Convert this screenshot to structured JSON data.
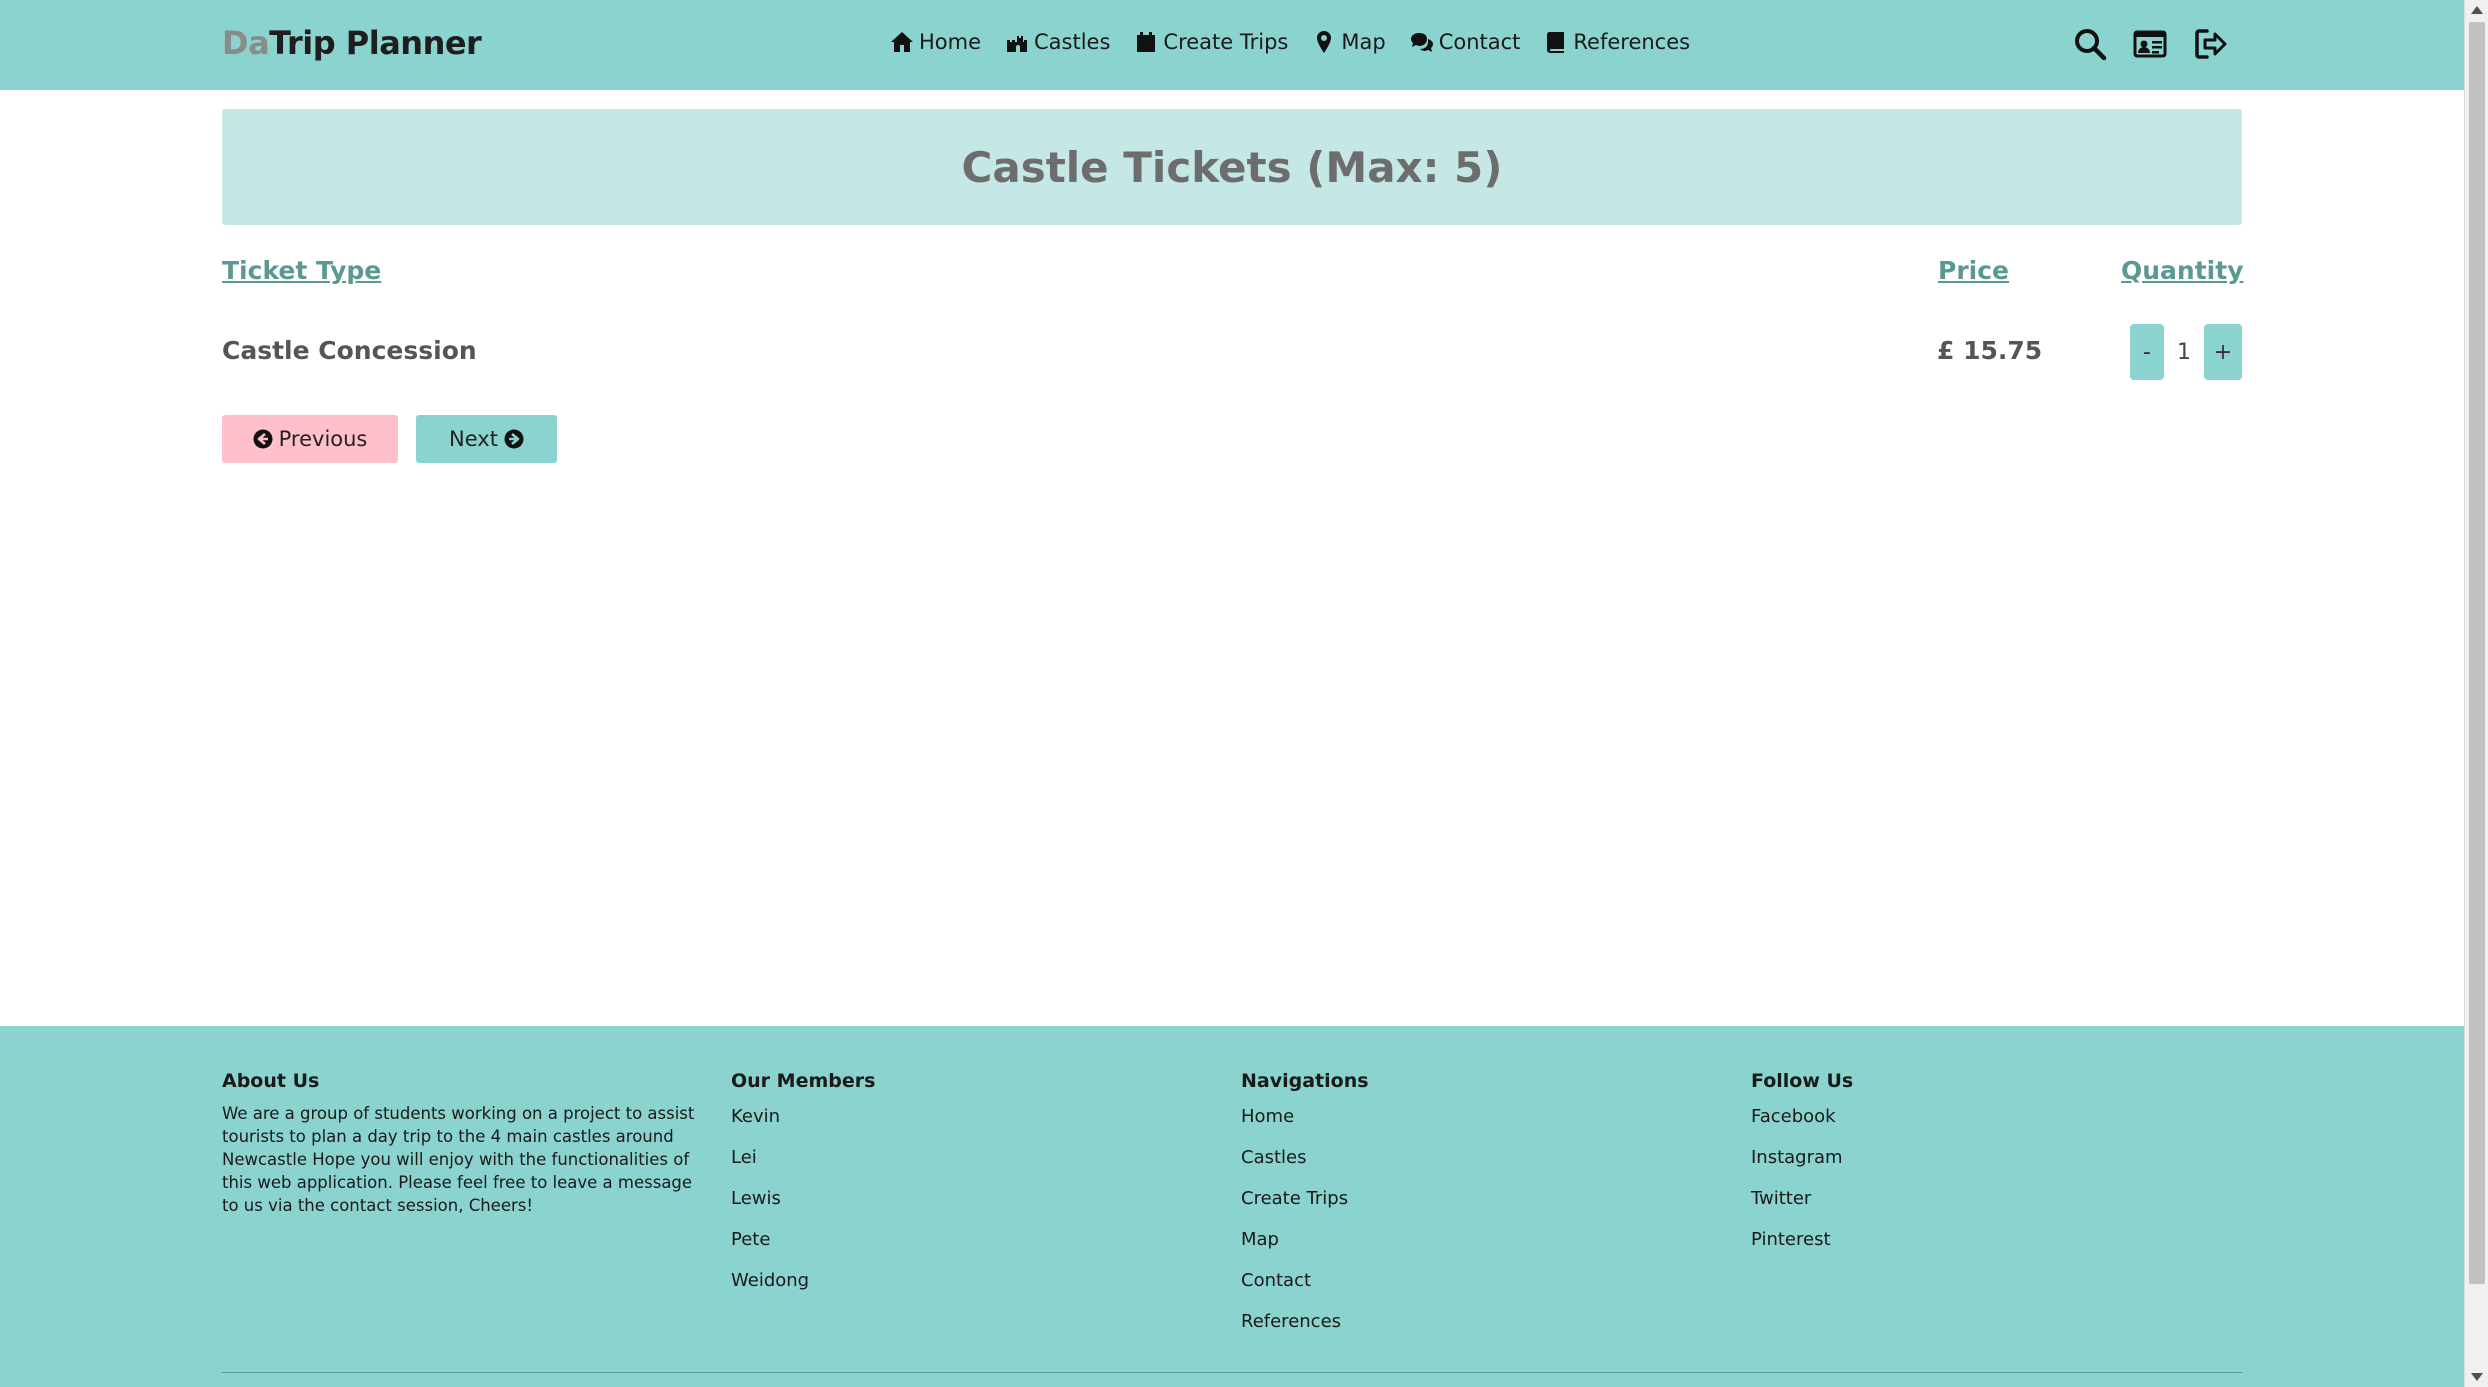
{
  "brand": {
    "prefix": "Da",
    "name": "Trip Planner"
  },
  "nav": {
    "items": [
      {
        "label": "Home",
        "icon": "home-icon"
      },
      {
        "label": "Castles",
        "icon": "castle-icon"
      },
      {
        "label": "Create Trips",
        "icon": "calendar-icon"
      },
      {
        "label": "Map",
        "icon": "map-marker-icon"
      },
      {
        "label": "Contact",
        "icon": "comments-icon"
      },
      {
        "label": "References",
        "icon": "book-icon"
      }
    ],
    "right_icons": [
      "search-icon",
      "id-card-icon",
      "sign-out-icon"
    ]
  },
  "page": {
    "title": "Castle Tickets (Max: 5)"
  },
  "table": {
    "headers": {
      "ticket_type": "Ticket Type",
      "price": "Price",
      "quantity": "Quantity"
    },
    "rows": [
      {
        "ticket_type": "Castle Concession",
        "price": "£ 15.75",
        "quantity": "1",
        "minus": "-",
        "plus": "+"
      }
    ]
  },
  "actions": {
    "previous": "Previous",
    "next": "Next"
  },
  "footer": {
    "about": {
      "title": "About Us",
      "text": "We are a group of students working on a project to assist tourists to plan a day trip to the 4 main castles around Newcastle Hope you will enjoy with the functionalities of this web application. Please feel free to leave a message to us via the contact session, Cheers!"
    },
    "members": {
      "title": "Our Members",
      "items": [
        "Kevin",
        "Lei",
        "Lewis",
        "Pete",
        "Weidong"
      ]
    },
    "navigations": {
      "title": "Navigations",
      "items": [
        "Home",
        "Castles",
        "Create Trips",
        "Map",
        "Contact",
        "References"
      ]
    },
    "follow": {
      "title": "Follow Us",
      "items": [
        "Facebook",
        "Instagram",
        "Twitter",
        "Pinterest"
      ]
    }
  },
  "colors": {
    "accent": "#8ad3ce",
    "title_panel": "#c5e8e6",
    "header_link": "#5c9893",
    "previous_button": "#ffc0cb"
  }
}
